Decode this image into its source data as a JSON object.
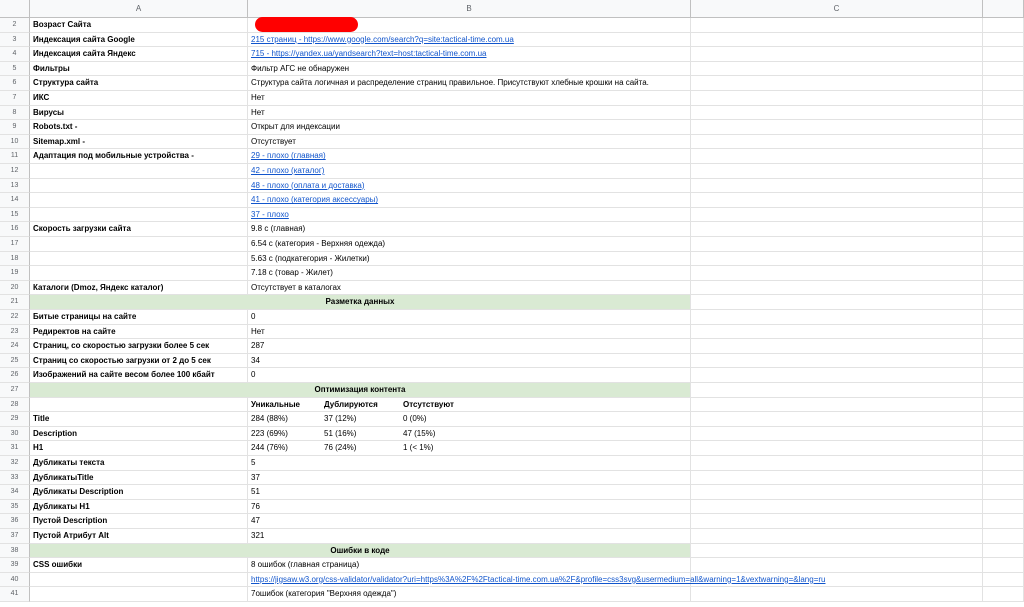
{
  "columns": [
    "A",
    "B",
    "C"
  ],
  "rows": [
    {
      "n": "2",
      "a": "Возраст Сайта",
      "b": ""
    },
    {
      "n": "3",
      "a": "Индексация сайта Google",
      "b": "215 страниц  -  https://www.google.com/search?q=site:tactical-time.com.ua",
      "link": true
    },
    {
      "n": "4",
      "a": "Индексация сайта Яндекс",
      "b": "715  -  https://yandex.ua/yandsearch?text=host:tactical-time.com.ua",
      "link": true
    },
    {
      "n": "5",
      "a": "Фильтры",
      "b": "Фильтр АГС не обнаружен"
    },
    {
      "n": "6",
      "a": "Структура сайта",
      "b": "Структура сайта логичная и распределение страниц правильное. Присутствуют хлебные крошки на сайта."
    },
    {
      "n": "7",
      "a": "ИКС",
      "b": "Нет"
    },
    {
      "n": "8",
      "a": "Вирусы",
      "b": "Нет"
    },
    {
      "n": "9",
      "a": "Robots.txt -",
      "b": "Открыт для индексации"
    },
    {
      "n": "10",
      "a": "Sitemap.xml -",
      "b": "Отсутствует"
    },
    {
      "n": "11",
      "a": "Адаптация под мобильные устройства -",
      "b": "29 - плохо (главная)",
      "link": true
    },
    {
      "n": "12",
      "a": "",
      "b": "42 - плохо (каталог)",
      "link": true
    },
    {
      "n": "13",
      "a": "",
      "b": "48 - плохо (оплата и доставка)",
      "link": true
    },
    {
      "n": "14",
      "a": "",
      "b": "41 - плохо (категория аксессуары)",
      "link": true
    },
    {
      "n": "15",
      "a": "",
      "b": "37 - плохо",
      "link": true
    },
    {
      "n": "16",
      "a": "Скорость загрузки сайта",
      "b": "9.8 с  (главная)"
    },
    {
      "n": "17",
      "a": "",
      "b": "6.54 с (категория - Верхняя одежда)"
    },
    {
      "n": "18",
      "a": "",
      "b": "5.63 с (подкатегория - Жилетки)"
    },
    {
      "n": "19",
      "a": "",
      "b": "7.18 с (товар - Жилет)"
    },
    {
      "n": "20",
      "a": "Каталоги (Dmoz, Яндекс каталог)",
      "b": "Отсутствует в каталогах"
    },
    {
      "n": "21",
      "section": "Разметка данных"
    },
    {
      "n": "22",
      "a": "Битые страницы на сайте",
      "b": "0"
    },
    {
      "n": "23",
      "a": "Редиректов на сайте",
      "b": "Нет"
    },
    {
      "n": "24",
      "a": "Страниц, со скоростью загрузки более 5 сек",
      "b": "287"
    },
    {
      "n": "25",
      "a": "Страниц со скоростью загрузки от 2 до 5 сек",
      "b": "34"
    },
    {
      "n": "26",
      "a": "Изображений на сайте весом более 100 кбайт",
      "b": "0"
    },
    {
      "n": "27",
      "section": "Оптимизация контента"
    },
    {
      "n": "28",
      "a": "",
      "sub": [
        "Уникальные",
        "Дублируются",
        "Отсутствуют"
      ],
      "subbold": true
    },
    {
      "n": "29",
      "a": "Title",
      "sub": [
        "284 (88%)",
        "37 (12%)",
        "0 (0%)"
      ]
    },
    {
      "n": "30",
      "a": "Description",
      "sub": [
        "223 (69%)",
        "51 (16%)",
        "47 (15%)"
      ]
    },
    {
      "n": "31",
      "a": "H1",
      "sub": [
        "244 (76%)",
        "76 (24%)",
        "1 (< 1%)"
      ]
    },
    {
      "n": "32",
      "a": "Дубликаты текста",
      "b": "5"
    },
    {
      "n": "33",
      "a": "ДубликатыTitle",
      "b": "37"
    },
    {
      "n": "34",
      "a": "Дубликаты Description",
      "b": "51"
    },
    {
      "n": "35",
      "a": "Дубликаты H1",
      "b": "76"
    },
    {
      "n": "36",
      "a": "Пустой Description",
      "b": "47"
    },
    {
      "n": "37",
      "a": "Пустой Атрибут Alt",
      "b": "321"
    },
    {
      "n": "38",
      "section": "Ошибки в коде"
    },
    {
      "n": "39",
      "a": "CSS ошибки",
      "b": "8 ошибок (главная страница)"
    },
    {
      "n": "40",
      "a": "",
      "b": "https://jigsaw.w3.org/css-validator/validator?uri=https%3A%2F%2Ftactical-time.com.ua%2F&profile=css3svg&usermedium=all&warning=1&vextwarning=&lang=ru",
      "link": true
    },
    {
      "n": "41",
      "a": "",
      "b": "7ошибок (категория \"Верхняя одежда\")"
    }
  ]
}
